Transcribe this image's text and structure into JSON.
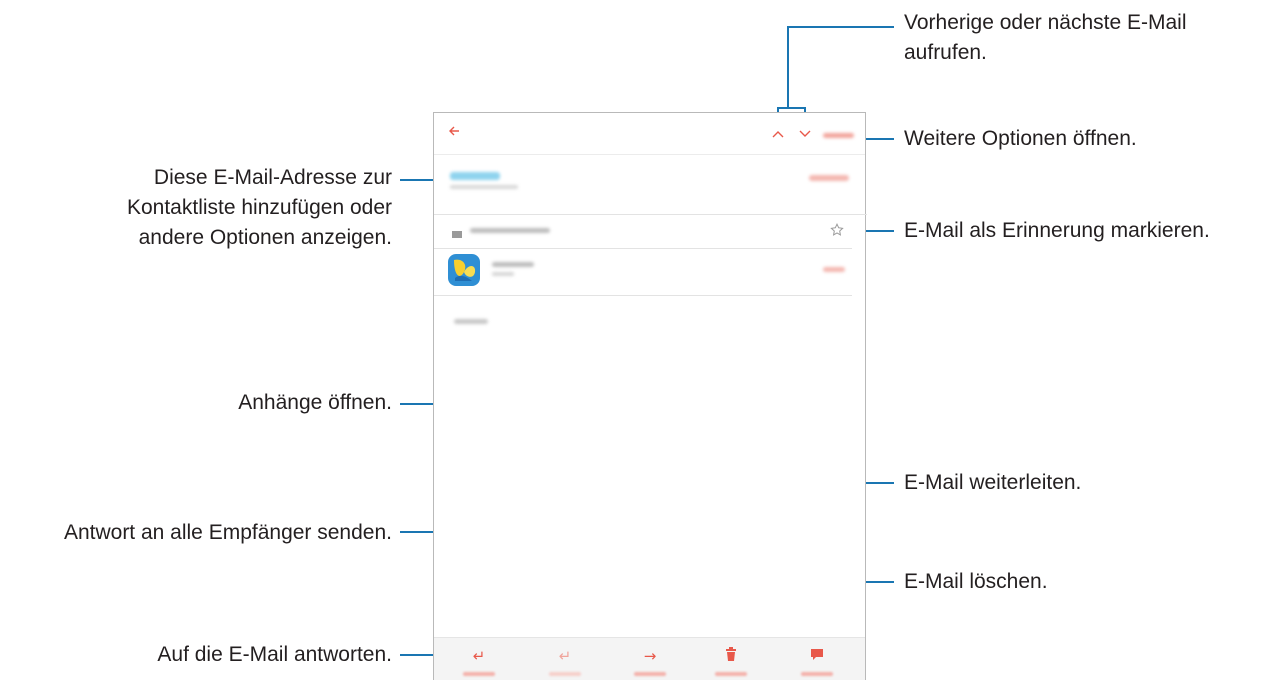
{
  "annotations": {
    "prev_next": [
      "Vorherige oder nächste E-Mail",
      "aufrufen."
    ],
    "more_options": "Weitere Optionen öffnen.",
    "add_contact": [
      "Diese E-Mail-Adresse zur",
      "Kontaktliste hinzufügen oder",
      "andere Optionen anzeigen."
    ],
    "mark_reminder": "E-Mail als Erinnerung markieren.",
    "open_attachments": "Anhänge öffnen.",
    "forward": "E-Mail weiterleiten.",
    "reply_all": "Antwort an alle Empfänger senden.",
    "delete": "E-Mail löschen.",
    "reply": "Auf die E-Mail antworten."
  },
  "app": {
    "icons": {
      "back": "arrow-left-icon",
      "prev": "chevron-up-icon",
      "next": "chevron-down-icon",
      "star": "star-outline-icon",
      "reply": "reply-icon",
      "reply_all": "reply-all-icon",
      "forward": "forward-icon",
      "delete": "trash-icon",
      "reminder": "message-icon"
    },
    "accent_color": "#e8584a",
    "callout_color": "#1a76b2"
  }
}
